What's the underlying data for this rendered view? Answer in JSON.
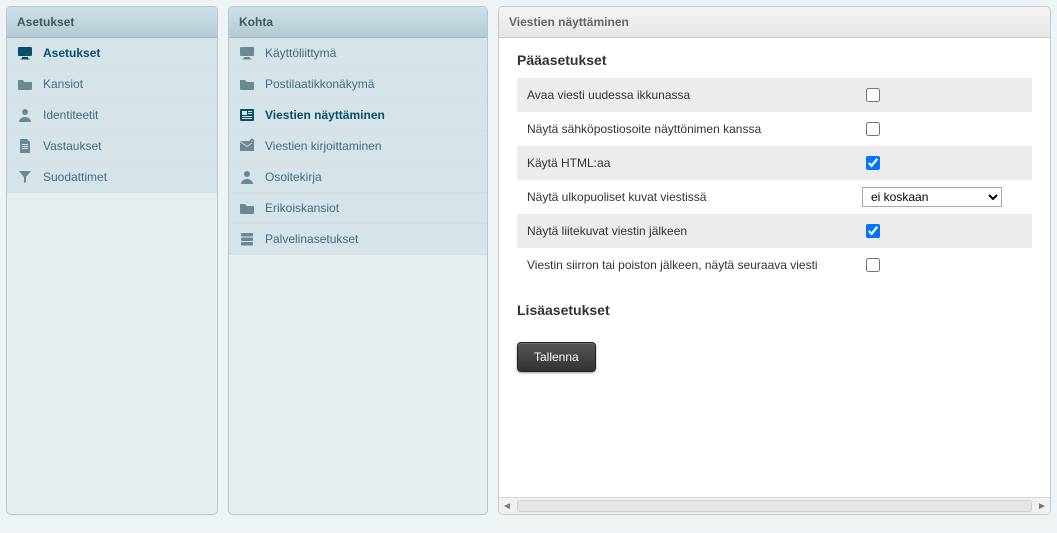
{
  "sidebar": {
    "title": "Asetukset",
    "items": [
      {
        "label": "Asetukset",
        "icon": "monitor-icon",
        "selected": true
      },
      {
        "label": "Kansiot",
        "icon": "folder-icon",
        "selected": false
      },
      {
        "label": "Identiteetit",
        "icon": "person-icon",
        "selected": false
      },
      {
        "label": "Vastaukset",
        "icon": "document-icon",
        "selected": false
      },
      {
        "label": "Suodattimet",
        "icon": "funnel-icon",
        "selected": false
      }
    ]
  },
  "sections": {
    "title": "Kohta",
    "items": [
      {
        "label": "Käyttöliittymä",
        "icon": "monitor-icon",
        "selected": false
      },
      {
        "label": "Postilaatikkonäkymä",
        "icon": "folder-icon",
        "selected": false
      },
      {
        "label": "Viestien näyttäminen",
        "icon": "news-icon",
        "selected": true
      },
      {
        "label": "Viestien kirjoittaminen",
        "icon": "compose-icon",
        "selected": false
      },
      {
        "label": "Osoitekirja",
        "icon": "person-icon",
        "selected": false
      },
      {
        "label": "Erikoiskansiot",
        "icon": "folder-icon",
        "selected": false
      },
      {
        "label": "Palvelinasetukset",
        "icon": "server-icon",
        "selected": false
      }
    ]
  },
  "form": {
    "title": "Viestien näyttäminen",
    "main_heading": "Pääasetukset",
    "rows": [
      {
        "label": "Avaa viesti uudessa ikkunassa",
        "type": "checkbox",
        "checked": false
      },
      {
        "label": "Näytä sähköpostiosoite näyttönimen kanssa",
        "type": "checkbox",
        "checked": false
      },
      {
        "label": "Käytä HTML:aa",
        "type": "checkbox",
        "checked": true
      },
      {
        "label": "Näytä ulkopuoliset kuvat viestissä",
        "type": "select",
        "value": "ei koskaan",
        "options": [
          "ei koskaan"
        ]
      },
      {
        "label": "Näytä liitekuvat viestin jälkeen",
        "type": "checkbox",
        "checked": true
      },
      {
        "label": "Viestin siirron tai poiston jälkeen, näytä seuraava viesti",
        "type": "checkbox",
        "checked": false
      }
    ],
    "extra_heading": "Lisäasetukset",
    "save_label": "Tallenna"
  }
}
